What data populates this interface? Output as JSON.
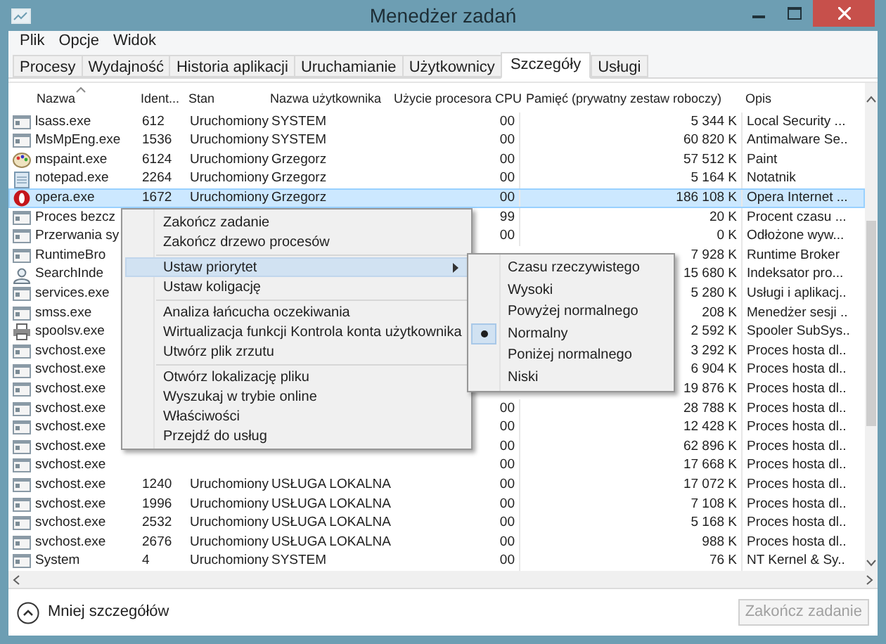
{
  "window": {
    "title": "Menedżer zadań"
  },
  "menu_bar": [
    "Plik",
    "Opcje",
    "Widok"
  ],
  "tabs": [
    {
      "label": "Procesy",
      "selected": false
    },
    {
      "label": "Wydajność",
      "selected": false
    },
    {
      "label": "Historia aplikacji",
      "selected": false
    },
    {
      "label": "Uruchamianie",
      "selected": false
    },
    {
      "label": "Użytkownicy",
      "selected": false
    },
    {
      "label": "Szczegóły",
      "selected": true
    },
    {
      "label": "Usługi",
      "selected": false
    }
  ],
  "table": {
    "columns": [
      "Nazwa",
      "Ident...",
      "Stan",
      "Nazwa użytkownika",
      "Użycie procesora CPU",
      "Pamięć (prywatny zestaw roboczy)",
      "Opis"
    ],
    "rows": [
      {
        "kind": "app",
        "name": "lsass.exe",
        "id": "612",
        "state": "Uruchomiony",
        "user": "SYSTEM",
        "cpu": "00",
        "memory": "5 344 K",
        "description": "Local Security ...",
        "selected": false
      },
      {
        "kind": "app",
        "name": "MsMpEng.exe",
        "id": "1536",
        "state": "Uruchomiony",
        "user": "SYSTEM",
        "cpu": "00",
        "memory": "60 820 K",
        "description": "Antimalware Se..",
        "selected": false
      },
      {
        "kind": "paint",
        "name": "mspaint.exe",
        "id": "6124",
        "state": "Uruchomiony",
        "user": "Grzegorz",
        "cpu": "00",
        "memory": "57 512 K",
        "description": "Paint",
        "selected": false
      },
      {
        "kind": "notepad",
        "name": "notepad.exe",
        "id": "2264",
        "state": "Uruchomiony",
        "user": "Grzegorz",
        "cpu": "00",
        "memory": "5 164 K",
        "description": "Notatnik",
        "selected": false
      },
      {
        "kind": "opera",
        "name": "opera.exe",
        "id": "1672",
        "state": "Uruchomiony",
        "user": "Grzegorz",
        "cpu": "00",
        "memory": "186 108 K",
        "description": "Opera Internet ...",
        "selected": true
      },
      {
        "kind": "app",
        "name": "Proces bezcz",
        "cpu": "99",
        "memory": "20 K",
        "description": "Procent czasu ...",
        "selected": false
      },
      {
        "kind": "app",
        "name": "Przerwania sy",
        "cpu": "00",
        "memory": "0 K",
        "description": "Odłożone wyw...",
        "selected": false
      },
      {
        "kind": "app",
        "name": "RuntimeBro",
        "memory": "7 928 K",
        "description": "Runtime Broker",
        "selected": false
      },
      {
        "kind": "search",
        "name": "SearchInde",
        "memory": "15 680 K",
        "description": "Indeksator pro...",
        "selected": false
      },
      {
        "kind": "app",
        "name": "services.exe",
        "memory": "5 280 K",
        "description": "Usługi i aplikacj..",
        "selected": false
      },
      {
        "kind": "app",
        "name": "smss.exe",
        "memory": "208 K",
        "description": "Menedżer sesji ..",
        "selected": false
      },
      {
        "kind": "printer",
        "name": "spoolsv.exe",
        "memory": "2 592 K",
        "description": "Spooler SubSys..",
        "selected": false
      },
      {
        "kind": "app",
        "name": "svchost.exe",
        "memory": "3 292 K",
        "description": "Proces hosta dl..",
        "selected": false
      },
      {
        "kind": "app",
        "name": "svchost.exe",
        "memory": "6 904 K",
        "description": "Proces hosta dl..",
        "selected": false
      },
      {
        "kind": "app",
        "name": "svchost.exe",
        "memory": "19 876 K",
        "description": "Proces hosta dl..",
        "selected": false
      },
      {
        "kind": "app",
        "name": "svchost.exe",
        "cpu": "00",
        "memory": "28 788 K",
        "description": "Proces hosta dl..",
        "selected": false
      },
      {
        "kind": "app",
        "name": "svchost.exe",
        "cpu": "00",
        "memory": "12 428 K",
        "description": "Proces hosta dl..",
        "selected": false
      },
      {
        "kind": "app",
        "name": "svchost.exe",
        "cpu": "00",
        "memory": "62 896 K",
        "description": "Proces hosta dl..",
        "selected": false
      },
      {
        "kind": "app",
        "name": "svchost.exe",
        "cpu": "00",
        "memory": "17 668 K",
        "description": "Proces hosta dl..",
        "selected": false
      },
      {
        "kind": "app",
        "name": "svchost.exe",
        "id": "1240",
        "state": "Uruchomiony",
        "user": "USŁUGA LOKALNA",
        "cpu": "00",
        "memory": "17 072 K",
        "description": "Proces hosta dl..",
        "selected": false
      },
      {
        "kind": "app",
        "name": "svchost.exe",
        "id": "1996",
        "state": "Uruchomiony",
        "user": "USŁUGA LOKALNA",
        "cpu": "00",
        "memory": "7 108 K",
        "description": "Proces hosta dl..",
        "selected": false
      },
      {
        "kind": "app",
        "name": "svchost.exe",
        "id": "2532",
        "state": "Uruchomiony",
        "user": "USŁUGA LOKALNA",
        "cpu": "00",
        "memory": "5 168 K",
        "description": "Proces hosta dl..",
        "selected": false
      },
      {
        "kind": "app",
        "name": "svchost.exe",
        "id": "2676",
        "state": "Uruchomiony",
        "user": "USŁUGA LOKALNA",
        "cpu": "00",
        "memory": "988 K",
        "description": "Proces hosta dl..",
        "selected": false
      },
      {
        "kind": "app",
        "name": "System",
        "id": "4",
        "state": "Uruchomiony",
        "user": "SYSTEM",
        "cpu": "00",
        "memory": "76 K",
        "description": "NT Kernel & Sy..",
        "selected": false
      }
    ]
  },
  "context_menu": {
    "groups": [
      [
        {
          "label": "Zakończ zadanie",
          "highlighted": false
        },
        {
          "label": "Zakończ drzewo procesów",
          "highlighted": false
        }
      ],
      [
        {
          "label": "Ustaw priorytet",
          "highlighted": true,
          "submenu": true
        },
        {
          "label": "Ustaw koligację",
          "highlighted": false
        }
      ],
      [
        {
          "label": "Analiza łańcucha oczekiwania",
          "highlighted": false
        },
        {
          "label": "Wirtualizacja funkcji Kontrola konta użytkownika",
          "highlighted": false
        },
        {
          "label": "Utwórz plik zrzutu",
          "highlighted": false
        }
      ],
      [
        {
          "label": "Otwórz lokalizację pliku",
          "highlighted": false
        },
        {
          "label": "Wyszukaj w trybie online",
          "highlighted": false
        },
        {
          "label": "Właściwości",
          "highlighted": false
        },
        {
          "label": "Przejdź do usług",
          "highlighted": false
        }
      ]
    ]
  },
  "priority_submenu": [
    {
      "label": "Czasu rzeczywistego",
      "selected": false
    },
    {
      "label": "Wysoki",
      "selected": false
    },
    {
      "label": "Powyżej normalnego",
      "selected": false
    },
    {
      "label": "Normalny",
      "selected": true
    },
    {
      "label": "Poniżej normalnego",
      "selected": false
    },
    {
      "label": "Niski",
      "selected": false
    }
  ],
  "footer": {
    "details_link": "Mniej szczegółów",
    "end_task_button": {
      "label": "Zakończ zadanie",
      "disabled": true
    }
  }
}
